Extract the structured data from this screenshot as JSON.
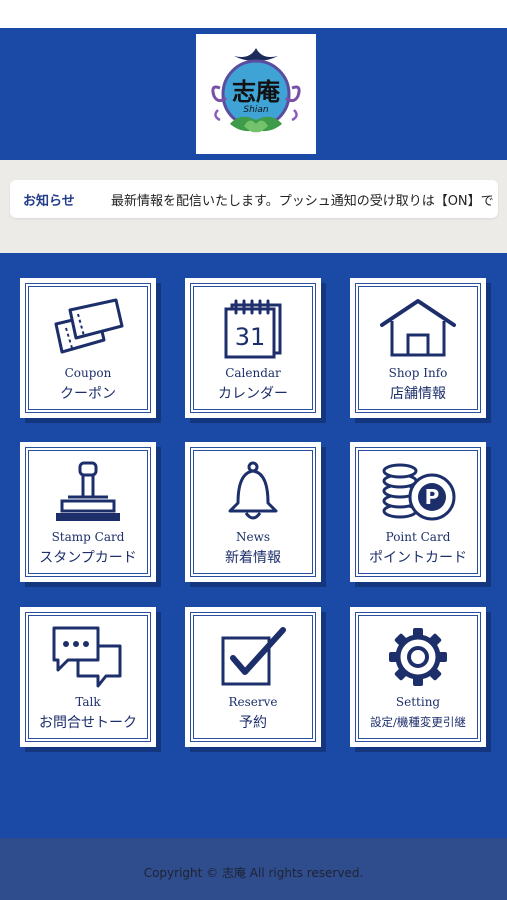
{
  "header": {
    "logo_text": "志庵",
    "logo_sub": "Shian"
  },
  "notice": {
    "label": "お知らせ",
    "text": "最新情報を配信いたします。プッシュ通知の受け取りは【ON】で"
  },
  "menu": [
    {
      "en": "Coupon",
      "jp": "クーポン",
      "icon": "coupon-ticket-icon"
    },
    {
      "en": "Calendar",
      "jp": "カレンダー",
      "icon": "calendar-icon",
      "icon_text": "31"
    },
    {
      "en": "Shop Info",
      "jp": "店舗情報",
      "icon": "shop-house-icon"
    },
    {
      "en": "Stamp Card",
      "jp": "スタンプカード",
      "icon": "stamp-icon"
    },
    {
      "en": "News",
      "jp": "新着情報",
      "icon": "bell-icon"
    },
    {
      "en": "Point Card",
      "jp": "ポイントカード",
      "icon": "point-coins-icon",
      "icon_text": "P"
    },
    {
      "en": "Talk",
      "jp": "お問合せトーク",
      "icon": "chat-bubbles-icon"
    },
    {
      "en": "Reserve",
      "jp": "予約",
      "icon": "checkbox-icon"
    },
    {
      "en": "Setting",
      "jp": "設定/機種変更引継",
      "icon": "gear-icon"
    }
  ],
  "footer": {
    "copyright": "Copyright © 志庵 All rights reserved."
  },
  "colors": {
    "primary_blue": "#1b4aa6",
    "footer_blue": "#2f4d8c",
    "icon_navy": "#1d2f6b"
  }
}
